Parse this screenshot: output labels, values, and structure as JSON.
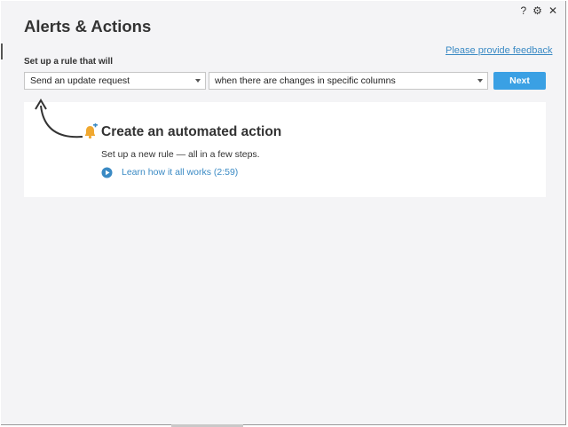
{
  "dialog": {
    "title": "Alerts & Actions",
    "icons": [
      "help-icon",
      "gear-icon",
      "close-icon"
    ],
    "help_glyph": "?",
    "gear_glyph": "⚙",
    "close_glyph": "✕"
  },
  "feedback_link": "Please provide feedback",
  "rule": {
    "label": "Set up a rule that will",
    "action_select": "Send an update request",
    "trigger_select": "when there are changes in specific columns",
    "next_label": "Next"
  },
  "panel": {
    "heading": "Create an automated action",
    "subtext": "Set up a new rule — all in a few steps.",
    "learn_link": "Learn how it all works (2:59)"
  },
  "colors": {
    "accent": "#3aa0e4",
    "link": "#3a8ac4",
    "bell": "#f0a830"
  }
}
